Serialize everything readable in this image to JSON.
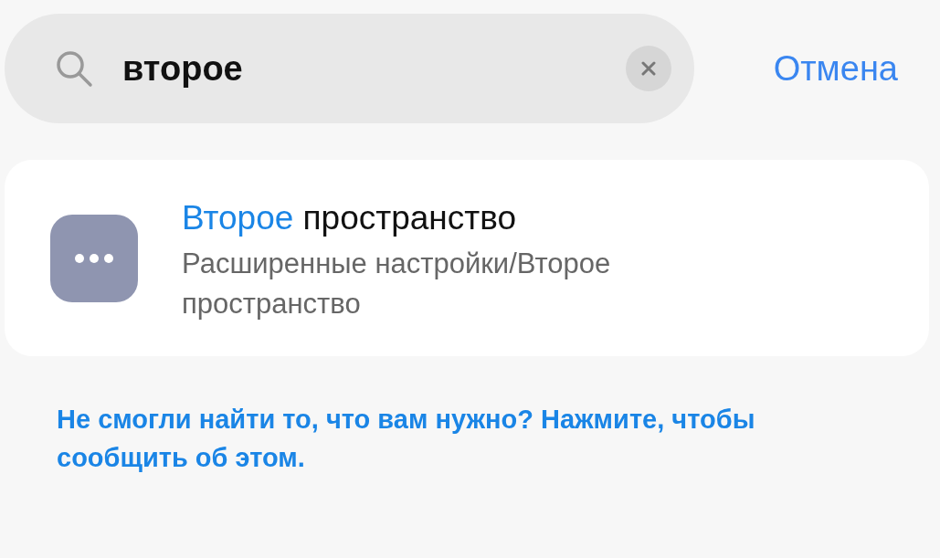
{
  "search": {
    "value": "второе",
    "cancel": "Отмена"
  },
  "results": [
    {
      "title": [
        {
          "text": "Второе",
          "highlight": true
        },
        {
          "text": " пространство",
          "highlight": false
        }
      ],
      "path": "Расширенные настройки/Второе пространство"
    }
  ],
  "feedback": "Не смогли найти то, что вам нужно? Нажмите, чтобы сообщить об этом."
}
